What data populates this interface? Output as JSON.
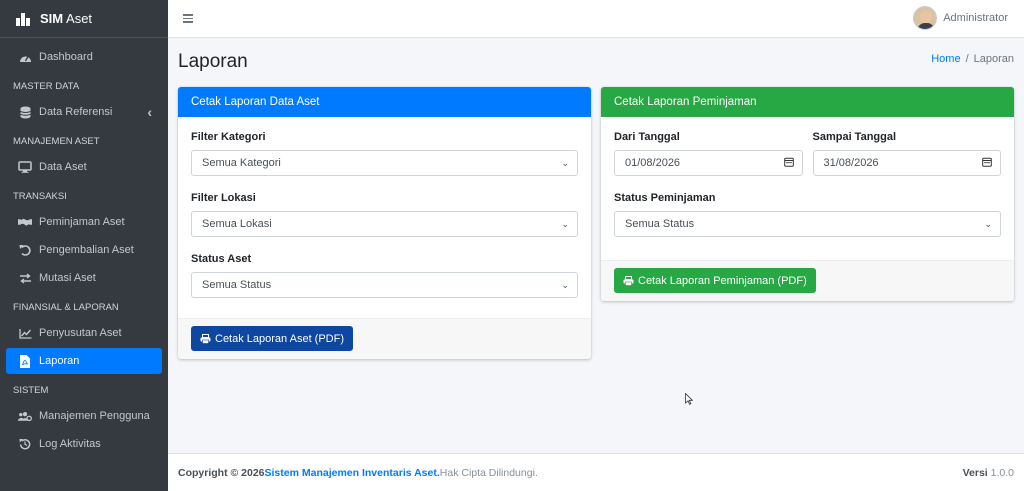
{
  "brand": {
    "name_bold": "SIM",
    "name_rest": " Aset"
  },
  "sidebar": {
    "items": [
      {
        "type": "item",
        "label": "Dashboard",
        "icon": "dashboard-icon"
      },
      {
        "type": "header",
        "label": "MASTER DATA"
      },
      {
        "type": "item",
        "label": "Data Referensi",
        "icon": "database-icon",
        "chevron": "‹"
      },
      {
        "type": "header",
        "label": "MANAJEMEN ASET"
      },
      {
        "type": "item",
        "label": "Data Aset",
        "icon": "desktop-icon"
      },
      {
        "type": "header",
        "label": "TRANSAKSI"
      },
      {
        "type": "item",
        "label": "Peminjaman Aset",
        "icon": "handshake-icon"
      },
      {
        "type": "item",
        "label": "Pengembalian Aset",
        "icon": "undo-icon"
      },
      {
        "type": "item",
        "label": "Mutasi Aset",
        "icon": "exchange-icon"
      },
      {
        "type": "header",
        "label": "FINANSIAL & LAPORAN"
      },
      {
        "type": "item",
        "label": "Penyusutan Aset",
        "icon": "chart-line-icon"
      },
      {
        "type": "item",
        "label": "Laporan",
        "icon": "file-pdf-icon",
        "active": true
      },
      {
        "type": "header",
        "label": "SISTEM"
      },
      {
        "type": "item",
        "label": "Manajemen Pengguna",
        "icon": "users-cog-icon"
      },
      {
        "type": "item",
        "label": "Log Aktivitas",
        "icon": "history-icon"
      }
    ]
  },
  "topbar": {
    "user_name": "Administrator"
  },
  "page": {
    "title": "Laporan",
    "breadcrumb_home": "Home",
    "breadcrumb_sep": "/",
    "breadcrumb_current": "Laporan"
  },
  "aset_card": {
    "title": "Cetak Laporan Data Aset",
    "color": "#007bff",
    "kategori_label": "Filter Kategori",
    "kategori_value": "Semua Kategori",
    "lokasi_label": "Filter Lokasi",
    "lokasi_value": "Semua Lokasi",
    "status_label": "Status Aset",
    "status_value": "Semua Status",
    "button_label": "Cetak Laporan Aset (PDF)",
    "button_color": "#0d47a1"
  },
  "pinjam_card": {
    "title": "Cetak Laporan Peminjaman",
    "color": "#28a745",
    "dari_label": "Dari Tanggal",
    "dari_value": "01/08/2026",
    "sampai_label": "Sampai Tanggal",
    "sampai_value": "31/08/2026",
    "status_label": "Status Peminjaman",
    "status_value": "Semua Status",
    "button_label": "Cetak Laporan Peminjaman (PDF)"
  },
  "footer": {
    "copyright": "Copyright © 2026 ",
    "app_name": "Sistem Manajemen Inventaris Aset.",
    "rights": " Hak Cipta Dilindungi.",
    "version_label": "Versi",
    "version_value": " 1.0.0"
  }
}
